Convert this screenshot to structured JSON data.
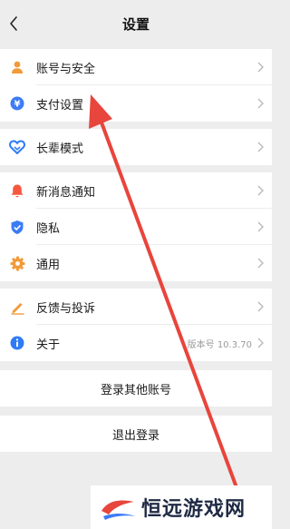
{
  "header": {
    "title": "设置"
  },
  "groups": {
    "g1": [
      {
        "label": "账号与安全",
        "icon": "person-icon",
        "color": "#f29a38"
      },
      {
        "label": "支付设置",
        "icon": "yen-icon",
        "color": "#3b7cf5"
      }
    ],
    "g2": [
      {
        "label": "长辈模式",
        "icon": "elder-heart-icon",
        "color": "#2f7bf6"
      }
    ],
    "g3": [
      {
        "label": "新消息通知",
        "icon": "bell-icon",
        "color": "#f5583f"
      },
      {
        "label": "隐私",
        "icon": "shield-check-icon",
        "color": "#3b7cf5"
      },
      {
        "label": "通用",
        "icon": "gear-icon",
        "color": "#f29a38"
      }
    ],
    "g4": [
      {
        "label": "反馈与投诉",
        "icon": "pencil-icon",
        "color": "#f29a38"
      },
      {
        "label": "关于",
        "icon": "info-icon",
        "color": "#2f7bf6",
        "value": "版本号 10.3.70"
      }
    ]
  },
  "buttons": {
    "login_other": "登录其他账号",
    "logout": "退出登录"
  },
  "annotation": {
    "arrow_color": "#e8453c"
  },
  "watermark": {
    "text": "恒远游戏网"
  }
}
